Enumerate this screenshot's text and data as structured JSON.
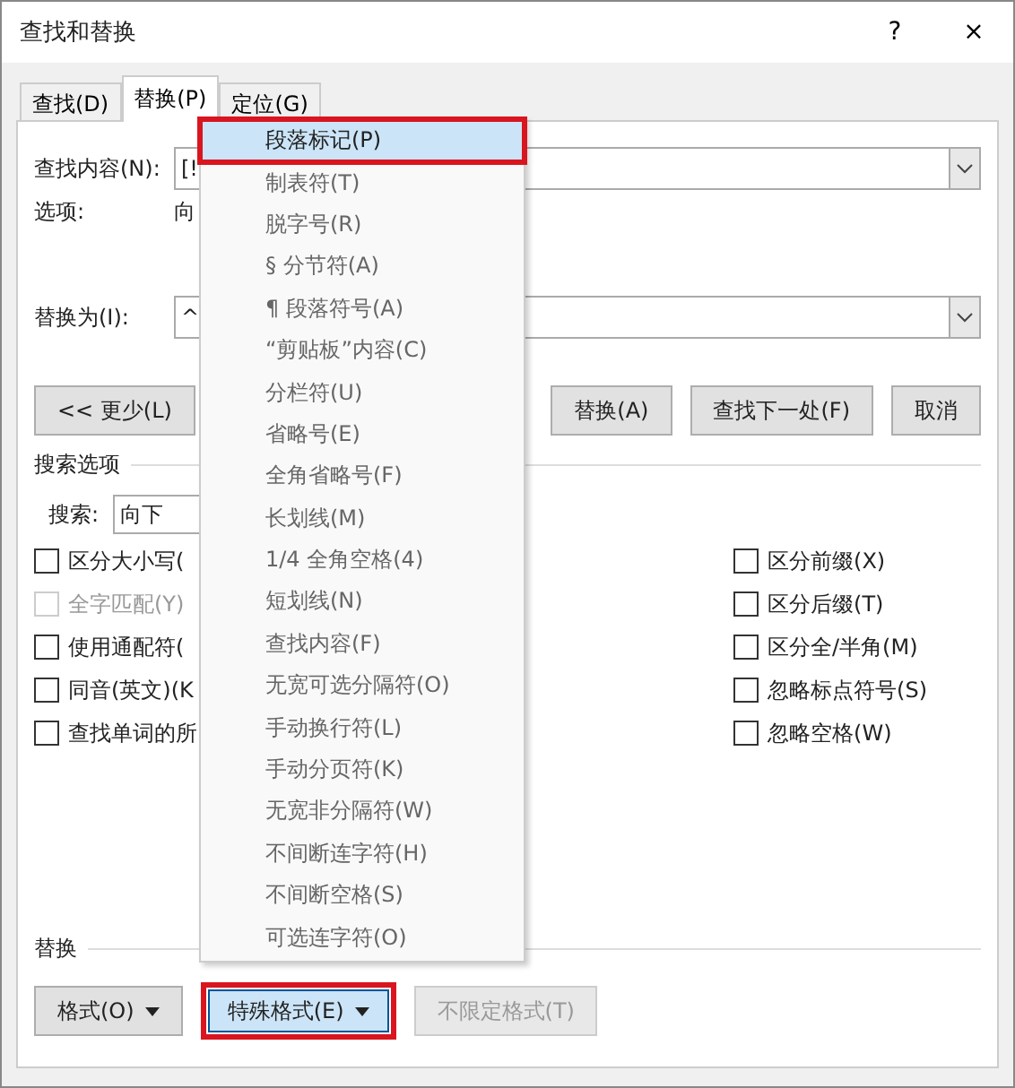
{
  "window": {
    "title": "查找和替换",
    "help": "?",
    "close": "×"
  },
  "tabs": [
    {
      "label": "查找(D)",
      "selected": false
    },
    {
      "label": "替换(P)",
      "selected": true
    },
    {
      "label": "定位(G)",
      "selected": false
    }
  ],
  "find": {
    "label": "查找内容(N):",
    "value": "[!"
  },
  "options": {
    "label": "选项:",
    "value": "向"
  },
  "replace": {
    "label": "替换为(I):",
    "value": "^"
  },
  "buttons": [
    {
      "label": "<< 更少(L)",
      "disabled": false
    },
    {
      "label": "替换(A)",
      "disabled": false
    },
    {
      "label": "查找下一处(F)",
      "disabled": false
    },
    {
      "label": "取消",
      "disabled": false
    }
  ],
  "search_options": {
    "title": "搜索选项",
    "search_label": "搜索:",
    "search_value": "向下"
  },
  "checkboxes_left": [
    {
      "label": "区分大小写(",
      "checked": false,
      "disabled": false
    },
    {
      "label": "全字匹配(Y)",
      "checked": false,
      "disabled": true
    },
    {
      "label": "使用通配符(",
      "checked": false,
      "disabled": false
    },
    {
      "label": "同音(英文)(K",
      "checked": false,
      "disabled": false
    },
    {
      "label": "查找单词的所",
      "checked": false,
      "disabled": false
    }
  ],
  "checkboxes_right": [
    {
      "label": "区分前缀(X)",
      "checked": false,
      "disabled": false
    },
    {
      "label": "区分后缀(T)",
      "checked": false,
      "disabled": false
    },
    {
      "label": "区分全/半角(M)",
      "checked": false,
      "disabled": false
    },
    {
      "label": "忽略标点符号(S)",
      "checked": false,
      "disabled": false
    },
    {
      "label": "忽略空格(W)",
      "checked": false,
      "disabled": false
    }
  ],
  "replace_section": {
    "title": "替换",
    "buttons": [
      {
        "label": "格式(O)",
        "dropdown": true,
        "disabled": false,
        "pressed": false,
        "annotated": false
      },
      {
        "label": "特殊格式(E)",
        "dropdown": true,
        "disabled": false,
        "pressed": true,
        "annotated": true
      },
      {
        "label": "不限定格式(T)",
        "dropdown": false,
        "disabled": true,
        "pressed": false,
        "annotated": false
      }
    ]
  },
  "menu": {
    "items": [
      {
        "label": "段落标记(P)",
        "selected": true,
        "annotated": true
      },
      {
        "label": "制表符(T)",
        "selected": false,
        "annotated": false
      },
      {
        "label": "脱字号(R)",
        "selected": false,
        "annotated": false
      },
      {
        "label": "§ 分节符(A)",
        "selected": false,
        "annotated": false
      },
      {
        "label": "¶ 段落符号(A)",
        "selected": false,
        "annotated": false
      },
      {
        "label": "“剪贴板”内容(C)",
        "selected": false,
        "annotated": false
      },
      {
        "label": "分栏符(U)",
        "selected": false,
        "annotated": false
      },
      {
        "label": "省略号(E)",
        "selected": false,
        "annotated": false
      },
      {
        "label": "全角省略号(F)",
        "selected": false,
        "annotated": false
      },
      {
        "label": "长划线(M)",
        "selected": false,
        "annotated": false
      },
      {
        "label": "1/4 全角空格(4)",
        "selected": false,
        "annotated": false
      },
      {
        "label": "短划线(N)",
        "selected": false,
        "annotated": false
      },
      {
        "label": "查找内容(F)",
        "selected": false,
        "annotated": false
      },
      {
        "label": "无宽可选分隔符(O)",
        "selected": false,
        "annotated": false
      },
      {
        "label": "手动换行符(L)",
        "selected": false,
        "annotated": false
      },
      {
        "label": "手动分页符(K)",
        "selected": false,
        "annotated": false
      },
      {
        "label": "无宽非分隔符(W)",
        "selected": false,
        "annotated": false
      },
      {
        "label": "不间断连字符(H)",
        "selected": false,
        "annotated": false
      },
      {
        "label": "不间断空格(S)",
        "selected": false,
        "annotated": false
      },
      {
        "label": "可选连字符(O)",
        "selected": false,
        "annotated": false
      }
    ]
  }
}
